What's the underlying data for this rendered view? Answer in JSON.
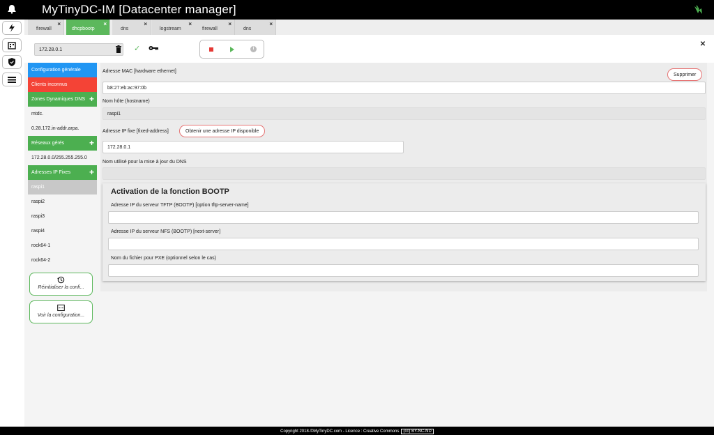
{
  "app": {
    "title": "MyTinyDC-IM [Datacenter manager]"
  },
  "tabs": [
    {
      "label": "firewall"
    },
    {
      "label": "dhcpbootp"
    },
    {
      "label": "dns"
    },
    {
      "label": "logstream"
    },
    {
      "label": "firewall"
    },
    {
      "label": "dns"
    }
  ],
  "toolbar": {
    "address": "172.28.0.1"
  },
  "menu": {
    "config": "Configuration générale",
    "clients": "Clients inconnus",
    "zones": "Zones Dynamiques DNS",
    "zone_items": [
      "mtdc.",
      "0.28.172.in-addr.arpa."
    ],
    "reseaux": "Réseaux gérés",
    "reseau_items": [
      "172.28.0.0/255.255.255.0"
    ],
    "fixes": "Adresses IP Fixes",
    "fixed_items": [
      "raspi1",
      "raspi2",
      "raspi3",
      "raspi4",
      "rock64-1",
      "rock64-2"
    ]
  },
  "actions": {
    "reset": "Réinitialiser la confi...",
    "view": "Voir la configuration..."
  },
  "form": {
    "mac_label": "Adresse MAC [hardware ethernet]",
    "delete_label": "Supprimer",
    "mac_value": "b8:27:eb:ac:97:0b",
    "hostname_label": "Nom hôte (hostname)",
    "hostname_value": "raspi1",
    "ip_label": "Adresse IP fixe [fixed-address]",
    "get_ip_label": "Obtenir une adresse IP disponible",
    "ip_value": "172.28.0.1",
    "dns_name_label": "Nom utilisé pour la mise à jour du DNS",
    "dns_name_value": ""
  },
  "bootp": {
    "title": "Activation de la fonction BOOTP",
    "tftp_label": "Adresse IP du serveur TFTP (BOOTP) [option tftp-server-name]",
    "nfs_label": "Adresse IP du serveur NFS (BOOTP) [next-server]",
    "pxe_label": "Nom du fichier pour PXE (optionnel selon le cas)"
  },
  "footer": {
    "copyright": "Copyright 2018-©",
    "link": "MyTinyDC.com",
    "licence": " - Licence : Creative Commons",
    "badge": "(cc) BY-NC-ND"
  },
  "colors": {
    "green": "#5cb85c",
    "blue": "#2196f3",
    "red": "#f44336"
  }
}
